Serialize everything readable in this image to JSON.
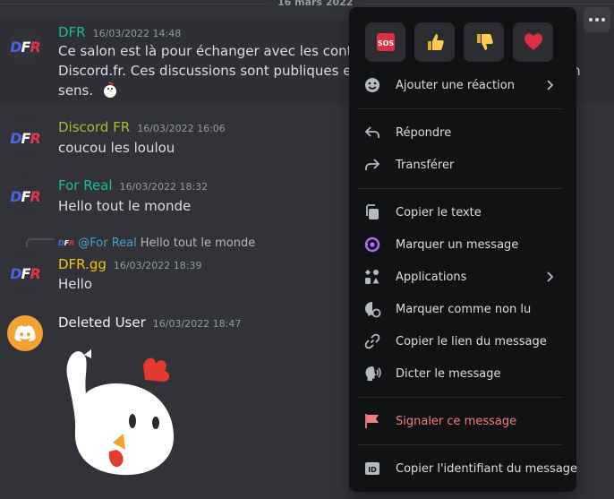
{
  "date_divider": "16 mars 2022",
  "messages": [
    {
      "user": "DFR",
      "user_color": "#1abc9c",
      "time": "16/03/2022 14:48",
      "lines": [
        "Ce salon est là pour échanger avec les contribut",
        "Discord.fr. Ces discussions sont publiques et dor",
        "sens."
      ],
      "trailing_text": "on"
    },
    {
      "user": "Discord FR",
      "user_color": "#a3be2b",
      "time": "16/03/2022 16:06",
      "text": "coucou les loulou"
    },
    {
      "user": "For Real",
      "user_color": "#1abc9c",
      "time": "16/03/2022 18:32",
      "text": "Hello tout le monde"
    },
    {
      "reply": {
        "mention": "@For Real",
        "text": "Hello tout le monde",
        "mini_avatar": "DFR"
      },
      "user": "DFR.gg",
      "user_color": "#f1c40f",
      "time": "16/03/2022 18:39",
      "text": "Hello"
    },
    {
      "user": "Deleted User",
      "user_color": "#f2f3f5",
      "time": "16/03/2022 18:47",
      "sticker": "chicken-sticker"
    }
  ],
  "avatar_text": {
    "d": "D",
    "f": "F",
    "r": "R"
  },
  "menu": {
    "reactions": [
      {
        "name": "sos-emoji",
        "glyph": "🆘"
      },
      {
        "name": "thumbs-up-emoji",
        "glyph": "👍"
      },
      {
        "name": "thumbs-down-emoji",
        "glyph": "👎"
      },
      {
        "name": "heart-emoji",
        "glyph": "❤"
      }
    ],
    "add_reaction": "Ajouter une réaction",
    "reply": "Répondre",
    "forward": "Transférer",
    "copy_text": "Copier le texte",
    "mark_message": "Marquer un message",
    "applications": "Applications",
    "mark_unread": "Marquer comme non lu",
    "copy_link": "Copier le lien du message",
    "speak": "Dicter le message",
    "report": "Signaler ce message",
    "copy_id": "Copier l'identifiant du message",
    "id_badge": "ID"
  },
  "colors": {
    "background": "#313338",
    "menu_bg": "#111214",
    "danger": "#f37d7f",
    "accent_purple": "#b26dff",
    "discord_avatar": "#f0a232"
  }
}
